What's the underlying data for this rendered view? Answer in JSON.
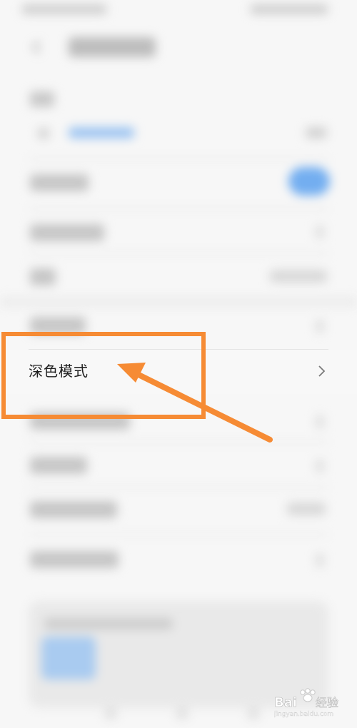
{
  "settings": {
    "dark_mode_label": "深色模式"
  },
  "annotation": {
    "color": "#f68b34"
  },
  "watermark": {
    "site": "jingyan.baidu.com"
  },
  "colors": {
    "toggle_on": "#73aef0",
    "background": "#f7f7f7"
  }
}
